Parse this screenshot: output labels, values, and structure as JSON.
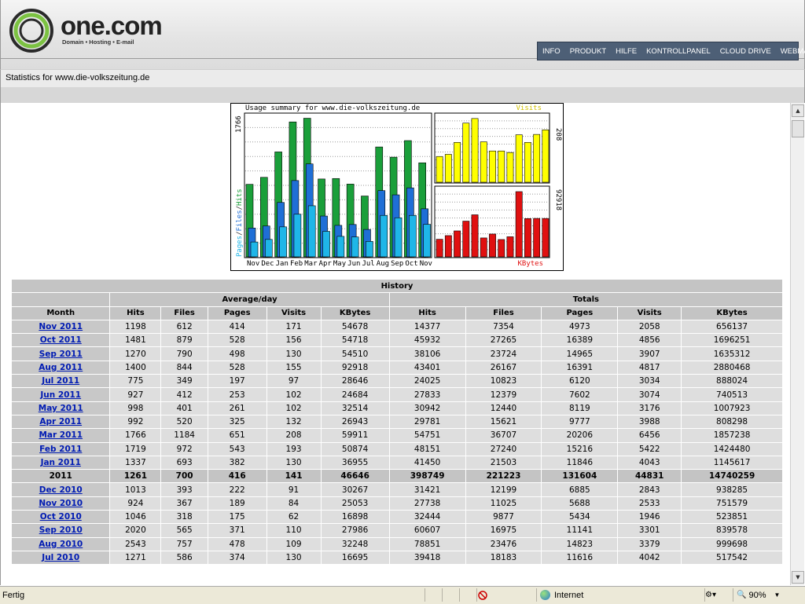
{
  "header": {
    "logo_word": "one.com",
    "logo_tagline": "Domain • Hosting • E-mail",
    "nav": [
      "INFO",
      "PRODUKT",
      "HILFE",
      "KONTROLLPANEL",
      "CLOUD DRIVE",
      "WEBMAIL"
    ]
  },
  "stats_bar": {
    "prefix": "Statistics for",
    "site": "www.die-volkszeitung.de"
  },
  "chart_data": {
    "type": "bar",
    "title": "Usage summary for www.die-volkszeitung.de",
    "categories": [
      "Nov",
      "Dec",
      "Jan",
      "Feb",
      "Mar",
      "Apr",
      "May",
      "Jun",
      "Jul",
      "Aug",
      "Sep",
      "Oct",
      "Nov"
    ],
    "series": [
      {
        "name": "Hits",
        "values": [
          924,
          1013,
          1337,
          1719,
          1766,
          992,
          998,
          927,
          775,
          1400,
          1270,
          1481,
          1198
        ],
        "color": "#1a9f3a"
      },
      {
        "name": "Files",
        "values": [
          367,
          393,
          693,
          972,
          1184,
          520,
          401,
          412,
          349,
          844,
          790,
          879,
          612
        ],
        "color": "#1f6fd6"
      },
      {
        "name": "Pages",
        "values": [
          189,
          222,
          382,
          543,
          651,
          325,
          261,
          253,
          197,
          528,
          498,
          528,
          414
        ],
        "color": "#1fb6e8"
      },
      {
        "name": "Visits",
        "values": [
          84,
          91,
          130,
          193,
          208,
          132,
          102,
          102,
          97,
          155,
          130,
          156,
          171
        ],
        "color": "#ffff00"
      },
      {
        "name": "KBytes",
        "values": [
          25053,
          30267,
          36955,
          50874,
          59911,
          26943,
          32514,
          24684,
          28646,
          92918,
          54510,
          54718,
          54678
        ],
        "color": "#e01010"
      }
    ],
    "ylabel_left": "Pages/Files/Hits",
    "max_left": 1766,
    "max_visits": 208,
    "max_kbytes": 92918,
    "label_visits": "Visits",
    "label_kbytes": "KBytes"
  },
  "history": {
    "title": "History",
    "group_avg": "Average/day",
    "group_tot": "Totals",
    "headers": [
      "Month",
      "Hits",
      "Files",
      "Pages",
      "Visits",
      "KBytes",
      "Hits",
      "Files",
      "Pages",
      "Visits",
      "KBytes"
    ],
    "rows": [
      {
        "label": "Nov 2011",
        "cells": [
          "1198",
          "612",
          "414",
          "171",
          "54678",
          "14377",
          "7354",
          "4973",
          "2058",
          "656137"
        ]
      },
      {
        "label": "Oct 2011",
        "cells": [
          "1481",
          "879",
          "528",
          "156",
          "54718",
          "45932",
          "27265",
          "16389",
          "4856",
          "1696251"
        ]
      },
      {
        "label": "Sep 2011",
        "cells": [
          "1270",
          "790",
          "498",
          "130",
          "54510",
          "38106",
          "23724",
          "14965",
          "3907",
          "1635312"
        ]
      },
      {
        "label": "Aug 2011",
        "cells": [
          "1400",
          "844",
          "528",
          "155",
          "92918",
          "43401",
          "26167",
          "16391",
          "4817",
          "2880468"
        ]
      },
      {
        "label": "Jul 2011",
        "cells": [
          "775",
          "349",
          "197",
          "97",
          "28646",
          "24025",
          "10823",
          "6120",
          "3034",
          "888024"
        ]
      },
      {
        "label": "Jun 2011",
        "cells": [
          "927",
          "412",
          "253",
          "102",
          "24684",
          "27833",
          "12379",
          "7602",
          "3074",
          "740513"
        ]
      },
      {
        "label": "May 2011",
        "cells": [
          "998",
          "401",
          "261",
          "102",
          "32514",
          "30942",
          "12440",
          "8119",
          "3176",
          "1007923"
        ]
      },
      {
        "label": "Apr 2011",
        "cells": [
          "992",
          "520",
          "325",
          "132",
          "26943",
          "29781",
          "15621",
          "9777",
          "3988",
          "808298"
        ]
      },
      {
        "label": "Mar 2011",
        "cells": [
          "1766",
          "1184",
          "651",
          "208",
          "59911",
          "54751",
          "36707",
          "20206",
          "6456",
          "1857238"
        ]
      },
      {
        "label": "Feb 2011",
        "cells": [
          "1719",
          "972",
          "543",
          "193",
          "50874",
          "48151",
          "27240",
          "15216",
          "5422",
          "1424480"
        ]
      },
      {
        "label": "Jan 2011",
        "cells": [
          "1337",
          "693",
          "382",
          "130",
          "36955",
          "41450",
          "21503",
          "11846",
          "4043",
          "1145617"
        ]
      },
      {
        "label": "2011",
        "year": true,
        "cells": [
          "1261",
          "700",
          "416",
          "141",
          "46646",
          "398749",
          "221223",
          "131604",
          "44831",
          "14740259"
        ]
      },
      {
        "label": "Dec 2010",
        "cells": [
          "1013",
          "393",
          "222",
          "91",
          "30267",
          "31421",
          "12199",
          "6885",
          "2843",
          "938285"
        ]
      },
      {
        "label": "Nov 2010",
        "cells": [
          "924",
          "367",
          "189",
          "84",
          "25053",
          "27738",
          "11025",
          "5688",
          "2533",
          "751579"
        ]
      },
      {
        "label": "Oct 2010",
        "cells": [
          "1046",
          "318",
          "175",
          "62",
          "16898",
          "32444",
          "9877",
          "5434",
          "1946",
          "523851"
        ]
      },
      {
        "label": "Sep 2010",
        "cells": [
          "2020",
          "565",
          "371",
          "110",
          "27986",
          "60607",
          "16975",
          "11141",
          "3301",
          "839578"
        ]
      },
      {
        "label": "Aug 2010",
        "cells": [
          "2543",
          "757",
          "478",
          "109",
          "32248",
          "78851",
          "23476",
          "14823",
          "3379",
          "999698"
        ]
      },
      {
        "label": "Jul 2010",
        "cells": [
          "1271",
          "586",
          "374",
          "130",
          "16695",
          "39418",
          "18183",
          "11616",
          "4042",
          "517542"
        ]
      }
    ]
  },
  "status": {
    "text": "Fertig",
    "zone": "Internet",
    "zoom": "90%"
  }
}
